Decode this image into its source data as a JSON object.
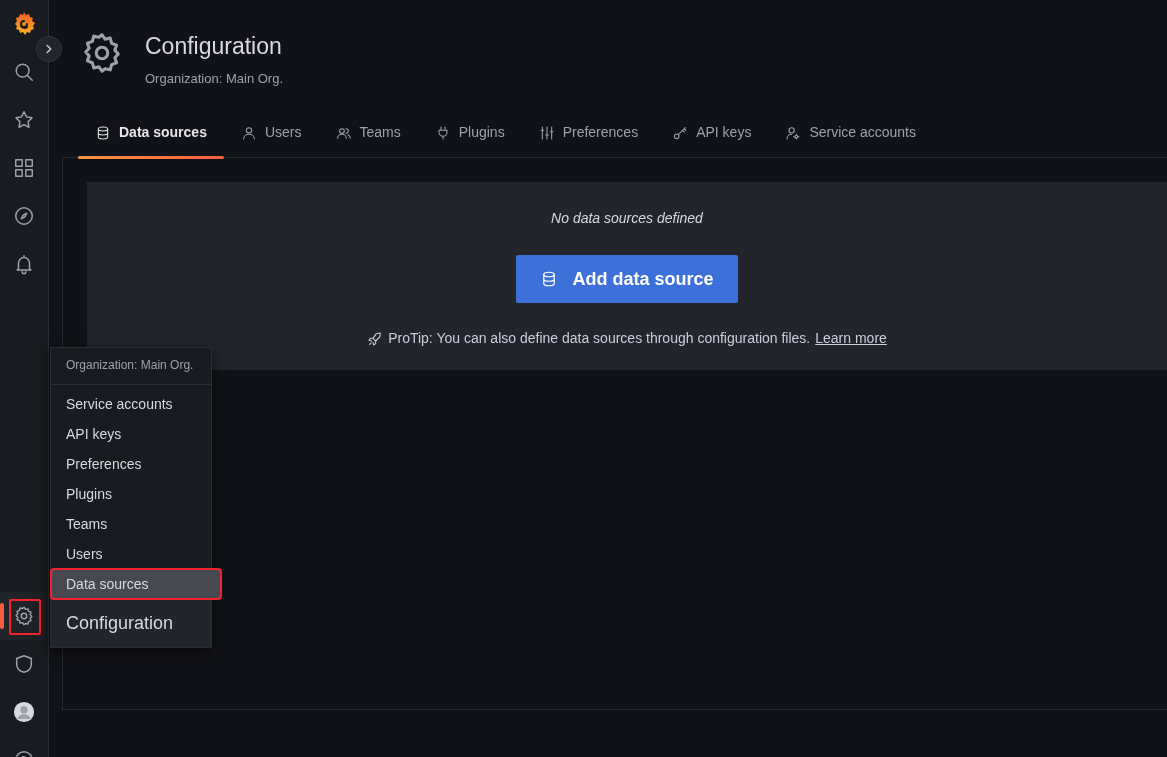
{
  "sidebar": {
    "items": [
      {
        "kind": "search",
        "active": false
      },
      {
        "kind": "star",
        "active": false
      },
      {
        "kind": "apps",
        "active": false
      },
      {
        "kind": "compass",
        "active": false
      },
      {
        "kind": "bell",
        "active": false
      }
    ],
    "bottom_items": [
      {
        "kind": "gear",
        "active": true,
        "annotated": true
      },
      {
        "kind": "shield",
        "active": false,
        "annotated": false
      },
      {
        "kind": "avatar",
        "active": false,
        "annotated": false
      },
      {
        "kind": "help",
        "active": false,
        "annotated": false
      }
    ]
  },
  "header": {
    "title": "Configuration",
    "subtitle": "Organization: Main Org."
  },
  "tabs": [
    {
      "label": "Data sources",
      "selected": true
    },
    {
      "label": "Users",
      "selected": false
    },
    {
      "label": "Teams",
      "selected": false
    },
    {
      "label": "Plugins",
      "selected": false
    },
    {
      "label": "Preferences",
      "selected": false
    },
    {
      "label": "API keys",
      "selected": false
    },
    {
      "label": "Service accounts",
      "selected": false
    }
  ],
  "empty_state": {
    "message": "No data sources defined",
    "button": "Add data source",
    "protip": "ProTip: You can also define data sources through configuration files.",
    "link": "Learn more"
  },
  "menu": {
    "header": "Organization: Main Org.",
    "items": [
      {
        "label": "Service accounts",
        "selected": false,
        "annotated": false
      },
      {
        "label": "API keys",
        "selected": false,
        "annotated": false
      },
      {
        "label": "Preferences",
        "selected": false,
        "annotated": false
      },
      {
        "label": "Plugins",
        "selected": false,
        "annotated": false
      },
      {
        "label": "Teams",
        "selected": false,
        "annotated": false
      },
      {
        "label": "Users",
        "selected": false,
        "annotated": false
      },
      {
        "label": "Data sources",
        "selected": true,
        "annotated": true
      }
    ],
    "title": "Configuration"
  }
}
